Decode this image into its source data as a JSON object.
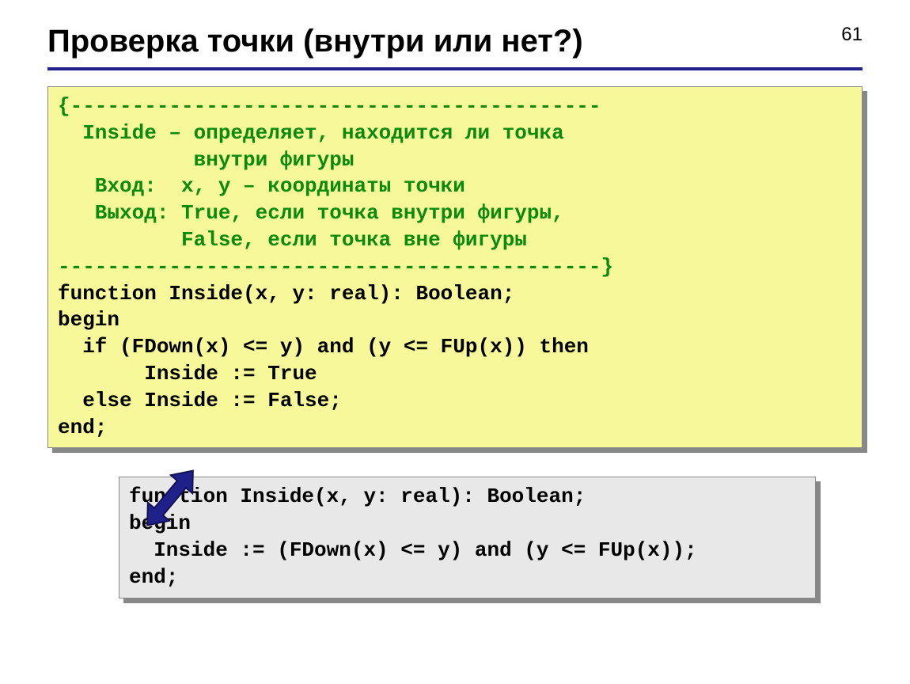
{
  "page_number": "61",
  "title": "Проверка точки (внутри или нет?)",
  "code1": {
    "c1": "{-------------------------------------------",
    "c2": "  Inside – определяет, находится ли точка",
    "c3": "           внутри фигуры",
    "c4": "   Вход:  x, y – координаты точки",
    "c5": "   Выход: True, если точка внутри фигуры,",
    "c6": "          False, если точка вне фигуры",
    "c7": "--------------------------------------------}",
    "l1": "function Inside(x, y: real): Boolean;",
    "l2": "begin",
    "l3": "  if (FDown(x) <= y) and (y <= FUp(x)) then",
    "l4": "       Inside := True",
    "l5": "  else Inside := False;",
    "l6": "end;"
  },
  "code2": {
    "l1": "function Inside(x, y: real): Boolean;",
    "l2": "begin",
    "l3": "  Inside := (FDown(x) <= y) and (y <= FUp(x));",
    "l4": "end;"
  }
}
